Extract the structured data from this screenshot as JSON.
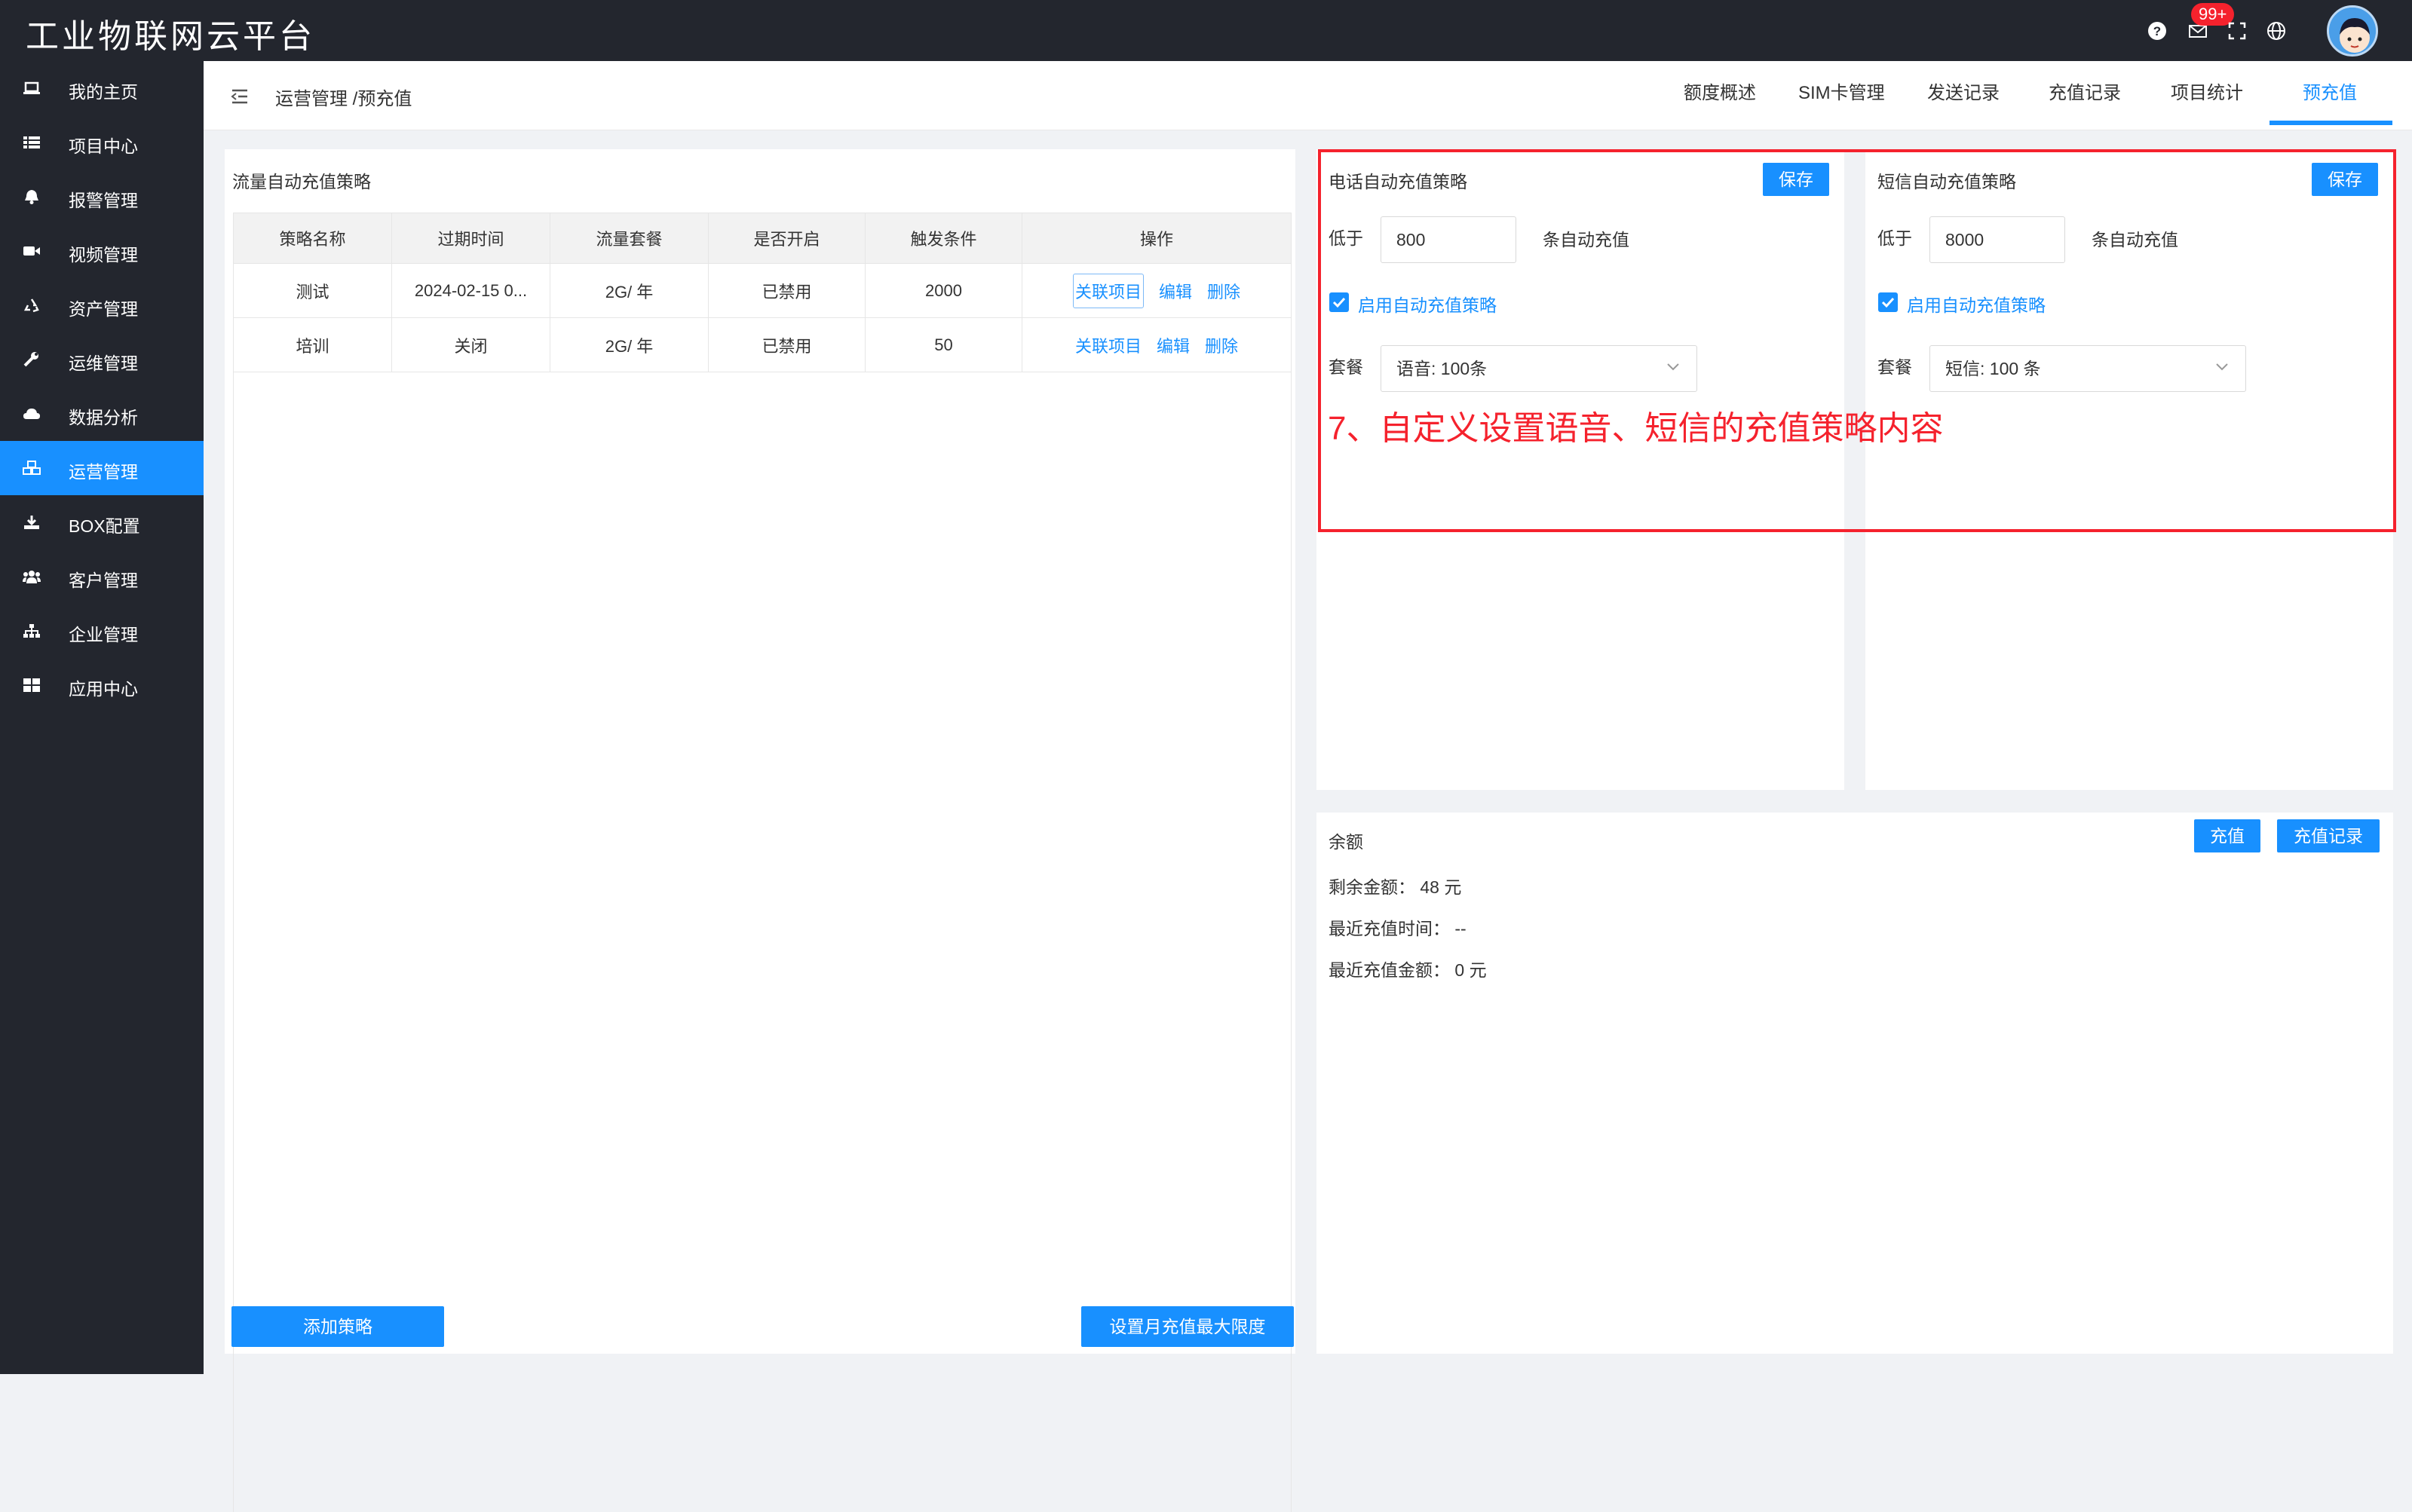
{
  "app": {
    "title": "工业物联网云平台",
    "notification_count": "99+"
  },
  "sidebar": {
    "items": [
      {
        "label": "我的主页",
        "icon": "laptop-icon"
      },
      {
        "label": "项目中心",
        "icon": "list-icon"
      },
      {
        "label": "报警管理",
        "icon": "bell-icon"
      },
      {
        "label": "视频管理",
        "icon": "video-camera-icon"
      },
      {
        "label": "资产管理",
        "icon": "recycle-icon"
      },
      {
        "label": "运维管理",
        "icon": "wrench-icon"
      },
      {
        "label": "数据分析",
        "icon": "cloud-icon"
      },
      {
        "label": "运营管理",
        "icon": "cubes-icon",
        "active": true
      },
      {
        "label": "BOX配置",
        "icon": "download-icon"
      },
      {
        "label": "客户管理",
        "icon": "users-icon"
      },
      {
        "label": "企业管理",
        "icon": "sitemap-icon"
      },
      {
        "label": "应用中心",
        "icon": "grid-icon"
      }
    ]
  },
  "header": {
    "breadcrumb": "运营管理 /预充值",
    "tabs": [
      {
        "label": "额度概述"
      },
      {
        "label": "SIM卡管理"
      },
      {
        "label": "发送记录"
      },
      {
        "label": "充值记录"
      },
      {
        "label": "项目统计"
      },
      {
        "label": "预充值",
        "active": true
      }
    ]
  },
  "flow_strategy": {
    "title": "流量自动充值策略",
    "columns": [
      "策略名称",
      "过期时间",
      "流量套餐",
      "是否开启",
      "触发条件",
      "操作"
    ],
    "rows": [
      {
        "name": "测试",
        "expire": "2024-02-15 0...",
        "package": "2G/ 年",
        "enabled": "已禁用",
        "trigger": "2000"
      },
      {
        "name": "培训",
        "expire": "关闭",
        "package": "2G/ 年",
        "enabled": "已禁用",
        "trigger": "50"
      }
    ],
    "actions": {
      "link": "关联项目",
      "edit": "编辑",
      "delete": "删除"
    },
    "add_button": "添加策略",
    "limit_button": "设置月充值最大限度"
  },
  "phone_strategy": {
    "title": "电话自动充值策略",
    "save": "保存",
    "below_label": "低于",
    "threshold": "800",
    "suffix": "条自动充值",
    "enable_label": "启用自动充值策略",
    "package_label": "套餐",
    "package_value": "语音: 100条"
  },
  "sms_strategy": {
    "title": "短信自动充值策略",
    "save": "保存",
    "below_label": "低于",
    "threshold": "8000",
    "suffix": "条自动充值",
    "enable_label": "启用自动充值策略",
    "package_label": "套餐",
    "package_value": "短信: 100 条"
  },
  "annotation": "7、自定义设置语音、短信的充值策略内容",
  "balance": {
    "title": "余额",
    "recharge": "充值",
    "records": "充值记录",
    "remaining_label": "剩余金额：",
    "remaining_value": "48 元",
    "last_time_label": "最近充值时间：",
    "last_time_value": "--",
    "last_amount_label": "最近充值金额：",
    "last_amount_value": "0 元"
  },
  "colors": {
    "accent": "#1890ff",
    "dark": "#23262e",
    "annotation": "#f5222d"
  }
}
